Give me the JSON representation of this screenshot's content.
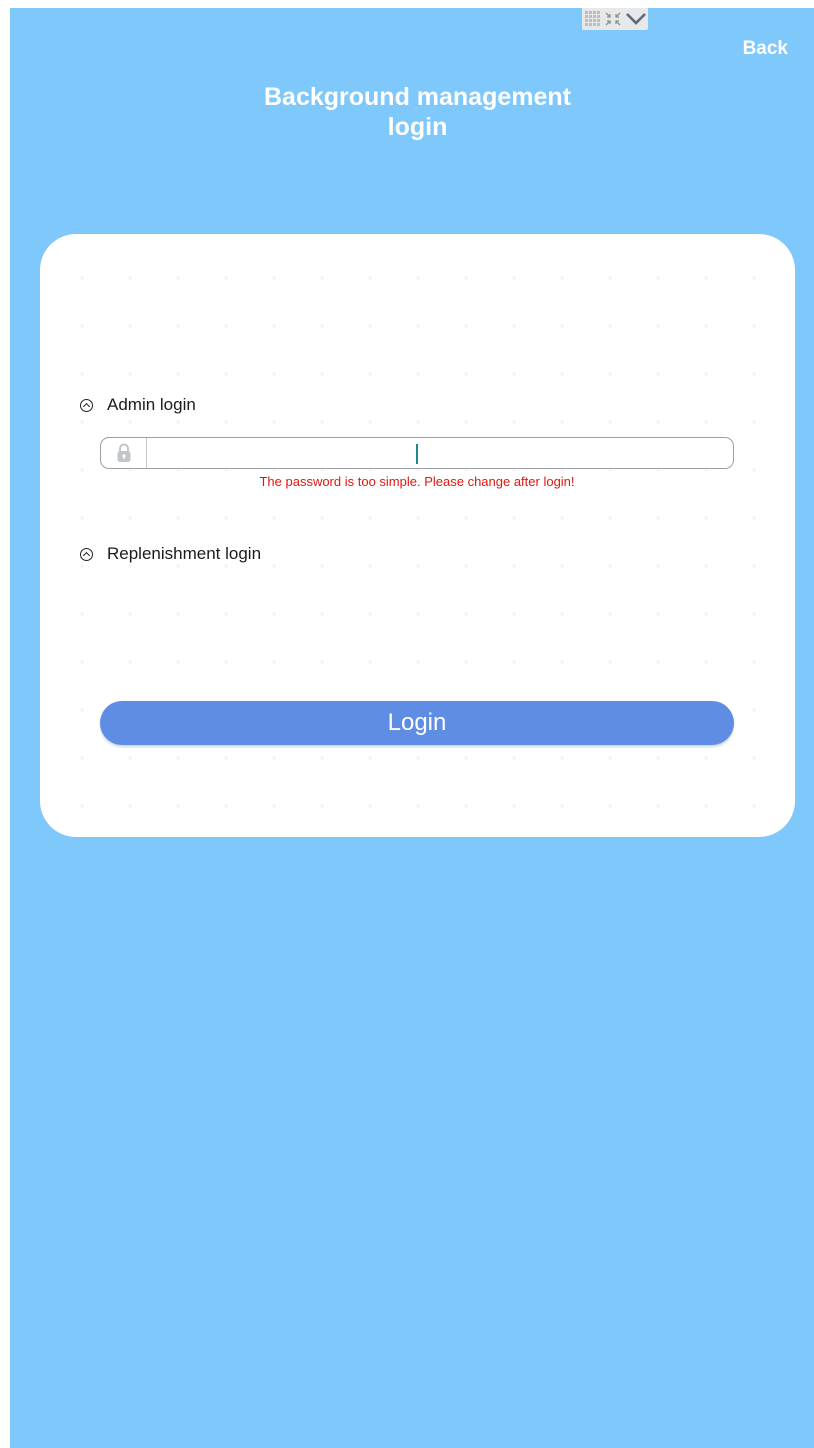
{
  "header": {
    "back_label": "Back",
    "title": "Background management login"
  },
  "admin_section": {
    "label": "Admin login",
    "password_value": "",
    "error_text": "The password is too simple. Please change after login!"
  },
  "replenishment_section": {
    "label": "Replenishment login"
  },
  "login_button": {
    "label": "Login"
  },
  "icons": {
    "keyboard_toggle": [
      "keyboard-grid-icon",
      "shrink-icon",
      "chevron-down-icon"
    ],
    "lock": "lock-icon",
    "section_toggle": "chevron-up-circle-icon"
  },
  "colors": {
    "background": "#7fc8fb",
    "card": "#ffffff",
    "button": "#5e8de3",
    "error": "#e3160f"
  }
}
